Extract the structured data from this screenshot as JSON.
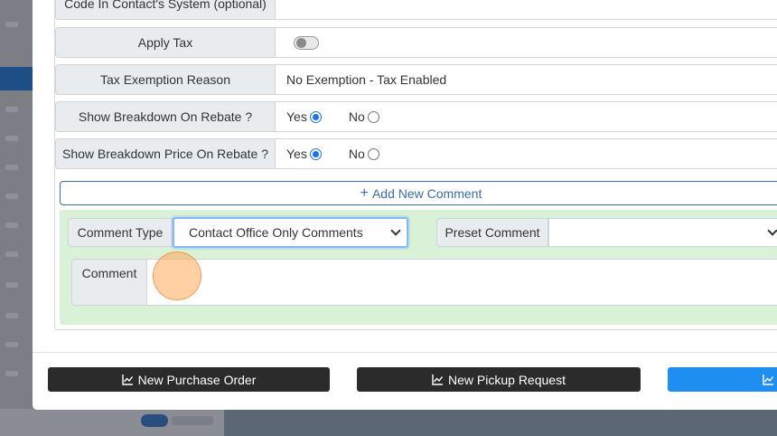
{
  "form": {
    "code_label": "Code In Contact's System (optional)",
    "apply_tax_label": "Apply Tax",
    "tax_exemption_label": "Tax Exemption Reason",
    "tax_exemption_value": "No Exemption - Tax Enabled",
    "breakdown_rebate_label": "Show Breakdown On Rebate ?",
    "breakdown_price_label": "Show Breakdown Price On Rebate ?",
    "yes_label": "Yes",
    "no_label": "No",
    "apply_tax_enabled": false
  },
  "comments": {
    "add_label": "Add New Comment",
    "type_label": "Comment Type",
    "type_value": "Contact Office Only Comments",
    "preset_label": "Preset Comment",
    "preset_value": "",
    "comment_label": "Comment",
    "comment_value": ""
  },
  "footer": {
    "purchase_order_label": "New Purchase Order",
    "pickup_request_label": "New Pickup Request"
  },
  "colors": {
    "primary": "#1e8ff0",
    "dark_button": "#2b2b2b",
    "comment_panel": "#d9f1d6",
    "outline": "#3a6ea5"
  }
}
